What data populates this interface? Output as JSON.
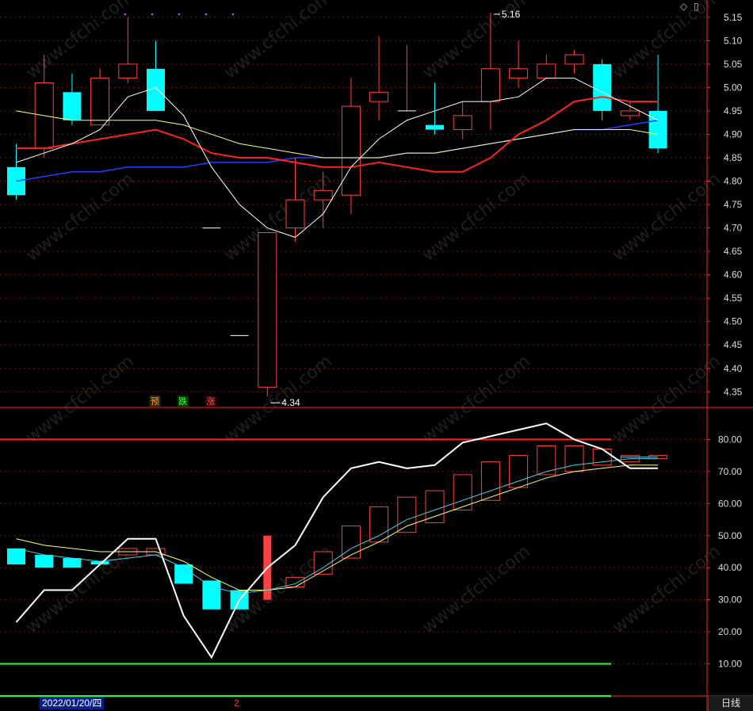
{
  "colors": {
    "up": "#ff4040",
    "down": "#00ffff",
    "ma5": "#ffffff",
    "ma10": "#ffff66",
    "ma20": "#ff2020",
    "ma60": "#2040ff",
    "grid": "#7a1010",
    "axis": "#ff2020",
    "kdj": "#ffffff",
    "line2": "#40d0e0",
    "line3": "#ffff66",
    "level80": "#ff2020",
    "level10": "#20ff20"
  },
  "chart_data": [
    {
      "type": "candlestick",
      "ylim": [
        4.3,
        5.2
      ],
      "ticks": [
        "5.15",
        "5.10",
        "5.05",
        "5.00",
        "4.95",
        "4.90",
        "4.85",
        "4.80",
        "4.75",
        "4.70",
        "4.65",
        "4.60",
        "4.55",
        "4.50",
        "4.45",
        "4.40",
        "4.35"
      ],
      "tick_values": [
        5.15,
        5.1,
        5.05,
        5.0,
        4.95,
        4.9,
        4.85,
        4.8,
        4.75,
        4.7,
        4.65,
        4.6,
        4.55,
        4.5,
        4.45,
        4.4,
        4.35
      ],
      "candles": [
        {
          "x": 0,
          "o": 4.83,
          "c": 4.77,
          "h": 4.88,
          "l": 4.76
        },
        {
          "x": 1,
          "o": 4.87,
          "c": 5.01,
          "h": 5.07,
          "l": 4.85
        },
        {
          "x": 2,
          "o": 4.99,
          "c": 4.93,
          "h": 5.03,
          "l": 4.92
        },
        {
          "x": 3,
          "o": 4.92,
          "c": 5.02,
          "h": 5.04,
          "l": 4.92
        },
        {
          "x": 4,
          "o": 5.02,
          "c": 5.05,
          "h": 5.15,
          "l": 5.01
        },
        {
          "x": 5,
          "o": 5.04,
          "c": 4.95,
          "h": 5.1,
          "l": 4.95
        },
        {
          "x": 7,
          "o": 4.7,
          "c": 4.7,
          "h": 4.7,
          "l": 4.7
        },
        {
          "x": 8,
          "o": 4.47,
          "c": 4.47,
          "h": 4.47,
          "l": 4.47
        },
        {
          "x": 9,
          "o": 4.36,
          "c": 4.69,
          "h": 4.69,
          "l": 4.34
        },
        {
          "x": 10,
          "o": 4.7,
          "c": 4.76,
          "h": 4.85,
          "l": 4.67
        },
        {
          "x": 11,
          "o": 4.76,
          "c": 4.78,
          "h": 4.82,
          "l": 4.7
        },
        {
          "x": 12,
          "o": 4.77,
          "c": 4.96,
          "h": 5.02,
          "l": 4.73
        },
        {
          "x": 13,
          "o": 4.97,
          "c": 4.99,
          "h": 5.11,
          "l": 4.93
        },
        {
          "x": 14,
          "o": 4.95,
          "c": 4.95,
          "h": 5.09,
          "l": 4.95
        },
        {
          "x": 15,
          "o": 4.92,
          "c": 4.91,
          "h": 5.01,
          "l": 4.9
        },
        {
          "x": 16,
          "o": 4.91,
          "c": 4.94,
          "h": 4.97,
          "l": 4.89
        },
        {
          "x": 17,
          "o": 4.97,
          "c": 5.04,
          "h": 5.16,
          "l": 4.91
        },
        {
          "x": 18,
          "o": 5.02,
          "c": 5.04,
          "h": 5.1,
          "l": 5.0
        },
        {
          "x": 19,
          "o": 5.02,
          "c": 5.05,
          "h": 5.07,
          "l": 5.02
        },
        {
          "x": 20,
          "o": 5.05,
          "c": 5.07,
          "h": 5.08,
          "l": 5.03
        },
        {
          "x": 21,
          "o": 5.05,
          "c": 4.95,
          "h": 5.06,
          "l": 4.93
        },
        {
          "x": 22,
          "o": 4.94,
          "c": 4.95,
          "h": 4.97,
          "l": 4.93
        },
        {
          "x": 23,
          "o": 4.95,
          "c": 4.87,
          "h": 5.07,
          "l": 4.86
        }
      ],
      "ma5": [
        4.84,
        4.86,
        4.88,
        4.91,
        4.98,
        5.0,
        4.94,
        4.83,
        4.75,
        4.7,
        4.68,
        4.73,
        4.83,
        4.89,
        4.93,
        4.95,
        4.97,
        4.97,
        4.98,
        5.02,
        5.02,
        4.99,
        4.96,
        4.93
      ],
      "ma10": [
        4.95,
        4.94,
        4.93,
        4.93,
        4.93,
        4.93,
        4.92,
        4.9,
        4.88,
        4.87,
        4.86,
        4.85,
        4.85,
        4.85,
        4.86,
        4.86,
        4.87,
        4.88,
        4.89,
        4.9,
        4.91,
        4.91,
        4.91,
        4.9
      ],
      "ma20": [
        4.87,
        4.87,
        4.88,
        4.89,
        4.9,
        4.91,
        4.89,
        4.86,
        4.85,
        4.85,
        4.84,
        4.83,
        4.83,
        4.84,
        4.83,
        4.82,
        4.82,
        4.85,
        4.9,
        4.93,
        4.97,
        4.98,
        4.97,
        4.97
      ],
      "ma60": [
        4.8,
        4.81,
        4.82,
        4.82,
        4.83,
        4.83,
        4.83,
        4.84,
        4.84,
        4.84,
        4.85,
        4.85,
        4.85,
        4.85,
        4.86,
        4.86,
        4.87,
        4.88,
        4.89,
        4.9,
        4.91,
        4.91,
        4.92,
        4.93
      ],
      "high_annotation": "5.16",
      "low_annotation": "4.34",
      "signals": [
        "预",
        "跌",
        "涨"
      ]
    },
    {
      "type": "oscillator",
      "ylim": [
        0,
        90
      ],
      "ticks": [
        "80.00",
        "70.00",
        "60.00",
        "50.00",
        "40.00",
        "30.00",
        "20.00",
        "10.00"
      ],
      "tick_values": [
        80,
        70,
        60,
        50,
        40,
        30,
        20,
        10
      ],
      "bars": [
        {
          "x": 0,
          "o": 46,
          "c": 41
        },
        {
          "x": 1,
          "o": 44,
          "c": 40
        },
        {
          "x": 2,
          "o": 43,
          "c": 40
        },
        {
          "x": 3,
          "o": 42,
          "c": 41
        },
        {
          "x": 4,
          "o": 44,
          "c": 46
        },
        {
          "x": 5,
          "o": 44,
          "c": 46
        },
        {
          "x": 6,
          "o": 41,
          "c": 35
        },
        {
          "x": 7,
          "o": 36,
          "c": 27
        },
        {
          "x": 8,
          "o": 33,
          "c": 27
        },
        {
          "x": 9,
          "o": 30,
          "c": 50
        },
        {
          "x": 10,
          "o": 34,
          "c": 37
        },
        {
          "x": 11,
          "o": 38,
          "c": 45
        },
        {
          "x": 12,
          "o": 43,
          "c": 53
        },
        {
          "x": 13,
          "o": 48,
          "c": 59
        },
        {
          "x": 14,
          "o": 51,
          "c": 62
        },
        {
          "x": 15,
          "o": 54,
          "c": 64
        },
        {
          "x": 16,
          "o": 58,
          "c": 69
        },
        {
          "x": 17,
          "o": 61,
          "c": 73
        },
        {
          "x": 18,
          "o": 65,
          "c": 75
        },
        {
          "x": 19,
          "o": 69,
          "c": 78
        },
        {
          "x": 20,
          "o": 70,
          "c": 78
        },
        {
          "x": 21,
          "o": 72,
          "c": 77
        },
        {
          "x": 22,
          "o": 73,
          "c": 75
        },
        {
          "x": 23,
          "o": 74,
          "c": 75
        }
      ],
      "line_main": [
        23,
        33,
        33,
        41,
        49,
        49,
        25,
        12,
        30,
        40,
        47,
        62,
        71,
        73,
        71,
        72,
        79,
        81,
        83,
        85,
        80,
        77,
        71,
        71
      ],
      "line_signal": [
        46,
        44,
        43,
        42,
        43,
        44,
        40,
        34,
        32,
        33,
        35,
        40,
        46,
        50,
        55,
        58,
        61,
        64,
        67,
        70,
        72,
        73,
        74,
        74
      ],
      "line_slow": [
        49,
        47,
        46,
        45,
        45,
        45,
        42,
        37,
        33,
        33,
        34,
        39,
        44,
        48,
        53,
        56,
        59,
        62,
        65,
        68,
        70,
        71,
        72,
        72
      ],
      "level_high": 80,
      "level_low": 10,
      "level_bottom": 0
    }
  ],
  "footer": {
    "date": "2022/01/20/四",
    "marker": "2",
    "period": "日线"
  },
  "watermark": "www.cfchi.com",
  "top_icons": [
    "◇",
    "▯"
  ]
}
